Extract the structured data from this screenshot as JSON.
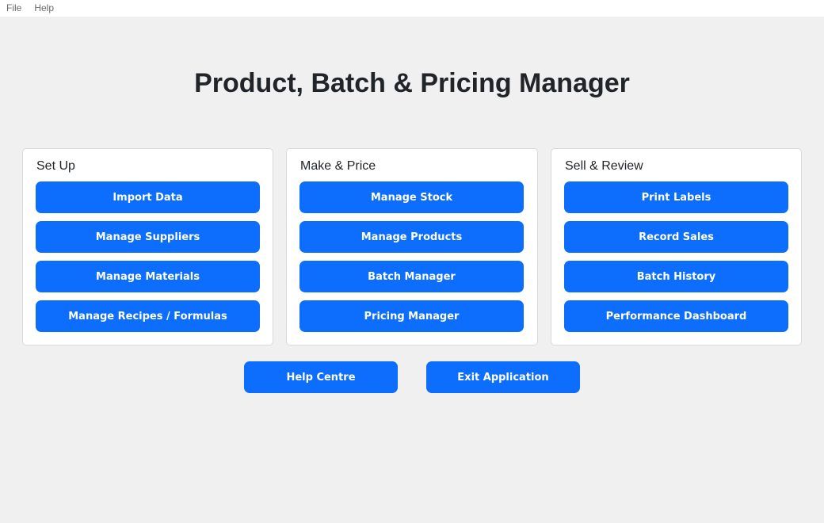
{
  "menu": [
    "File",
    "Help"
  ],
  "title": "Product, Batch & Pricing Manager",
  "panels": [
    {
      "title": "Set Up",
      "buttons": [
        "Import Data",
        "Manage Suppliers",
        "Manage Materials",
        "Manage Recipes / Formulas"
      ]
    },
    {
      "title": "Make & Price",
      "buttons": [
        "Manage Stock",
        "Manage Products",
        "Batch Manager",
        "Pricing Manager"
      ]
    },
    {
      "title": "Sell & Review",
      "buttons": [
        "Print Labels",
        "Record Sales",
        "Batch History",
        "Performance Dashboard"
      ]
    }
  ],
  "footer": {
    "help": "Help Centre",
    "exit": "Exit Application"
  },
  "colors": {
    "background": "#f0f0f0",
    "accent": "#0d6efd",
    "panel": "#ffffff",
    "title": "#212529"
  }
}
